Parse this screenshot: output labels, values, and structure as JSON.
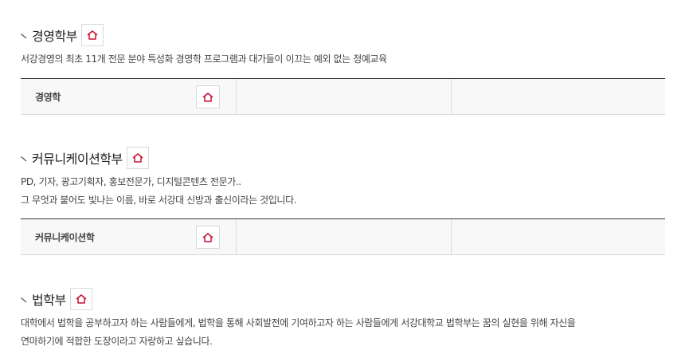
{
  "sections": [
    {
      "title": "경영학부",
      "home_icon": "home-icon",
      "description": [
        "서강경영의 최초 11개 전문 분야 특성화 경영학 프로그램과 대가들이 이끄는 예외 없는 정예교육"
      ],
      "majors": [
        "경영학",
        "",
        ""
      ]
    },
    {
      "title": "커뮤니케이션학부",
      "home_icon": "home-icon",
      "description": [
        "PD, 기자, 광고기획자, 홍보전문가, 디지털콘텐츠 전문가..",
        "그 무엇과 붙어도 빛나는 이름, 바로 서강대 신방과 출신이라는 것입니다."
      ],
      "majors": [
        "커뮤니케이션학",
        "",
        ""
      ]
    },
    {
      "title": "법학부",
      "home_icon": "home-icon",
      "description": [
        "대학에서 법학을 공부하고자 하는 사람들에게, 법학을 통해 사회발전에 기여하고자 하는 사람들에게 서강대학교 법학부는 꿈의 실현을 위해 자신을",
        "연마하기에 적합한 도장이라고 자랑하고 싶습니다."
      ]
    }
  ],
  "colors": {
    "accent": "#c8102e",
    "border_dark": "#333333",
    "cell_bg": "#f8f8f8"
  }
}
